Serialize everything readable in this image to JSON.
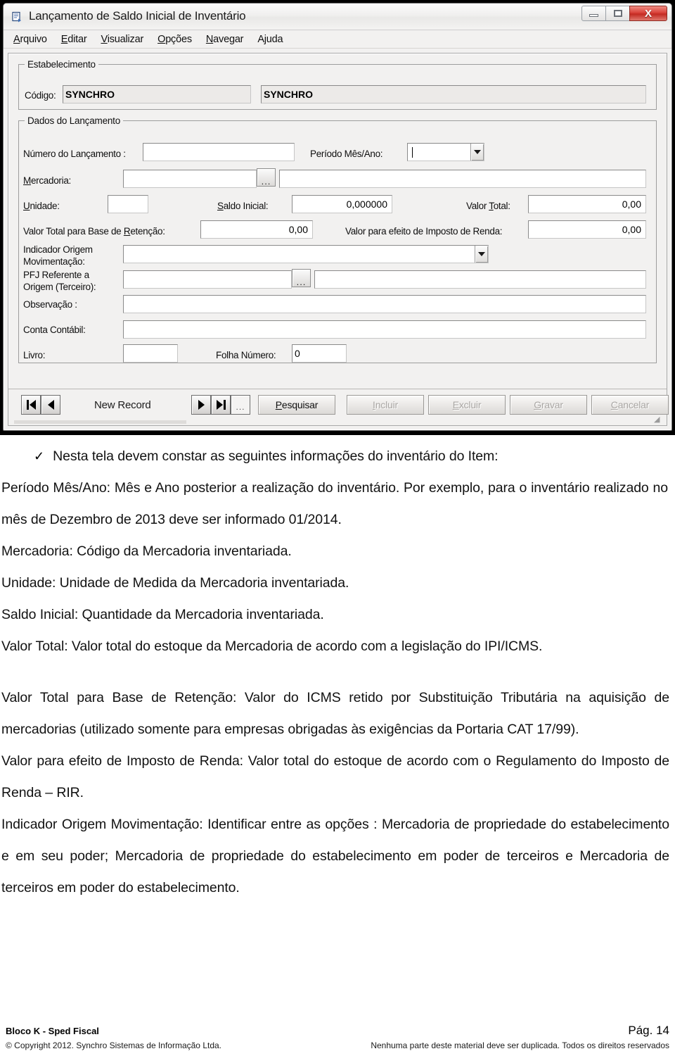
{
  "window": {
    "title": "Lançamento de Saldo Inicial de Inventário",
    "titlebar_icon": "app-document-icon",
    "controls": {
      "minimize": "minimize-icon",
      "maximize": "maximize-icon",
      "close_label": "X"
    },
    "menu": [
      {
        "label": "Arquivo",
        "accel": "A"
      },
      {
        "label": "Editar",
        "accel": "E"
      },
      {
        "label": "Visualizar",
        "accel": "V"
      },
      {
        "label": "Opções",
        "accel": "O"
      },
      {
        "label": "Navegar",
        "accel": "N"
      },
      {
        "label": "Ajuda",
        "accel": ""
      }
    ],
    "group_estabelecimento": {
      "legend": "Estabelecimento",
      "codigo_label": "Código:",
      "codigo_value": "SYNCHRO",
      "nome_value": "SYNCHRO"
    },
    "group_dados": {
      "legend": "Dados do Lançamento",
      "numero_lancamento_label": "Número do Lançamento :",
      "numero_lancamento_value": "",
      "periodo_label": "Período Mês/Ano:",
      "periodo_value": "",
      "mercadoria_label": "Mercadoria:",
      "mercadoria_accel": "M",
      "mercadoria_value": "",
      "mercadoria_desc_value": "",
      "mercadoria_lookup_label": "...",
      "unidade_label": "Unidade:",
      "unidade_accel": "U",
      "unidade_value": "",
      "saldo_inicial_label": "Saldo Inicial:",
      "saldo_inicial_accel": "S",
      "saldo_inicial_value": "0,000000",
      "valor_total_label": "Valor Total:",
      "valor_total_accel": "T",
      "valor_total_value": "0,00",
      "base_retencao_label": "Valor Total para Base de Retenção:",
      "base_retencao_accel": "R",
      "base_retencao_value": "0,00",
      "imposto_renda_label": "Valor para efeito de Imposto de Renda:",
      "imposto_renda_value": "0,00",
      "indicador_origem_label_l1": "Indicador Origem",
      "indicador_origem_label_l2": "Movimentação:",
      "indicador_origem_value": "",
      "pfj_label_l1": "PFJ Referente a",
      "pfj_label_l2": "Origem (Terceiro):",
      "pfj_value": "",
      "pfj_desc_value": "",
      "pfj_lookup_label": "...",
      "observacao_label": "Observação :",
      "observacao_value": "",
      "conta_contabil_label": "Conta Contábil:",
      "conta_contabil_value": "",
      "livro_label": "Livro:",
      "livro_value": "",
      "folha_numero_label": "Folha Número:",
      "folha_numero_value": "0"
    },
    "toolbar": {
      "record_status": "New Record",
      "first_icon": "first-record-icon",
      "prev_icon": "previous-record-icon",
      "next_icon": "next-record-icon",
      "last_icon": "last-record-icon",
      "more_label": "...",
      "pesquisar_label": "Pesquisar",
      "pesquisar_accel": "P",
      "incluir_label": "Incluir",
      "incluir_accel": "I",
      "excluir_label": "Excluir",
      "excluir_accel": "E",
      "gravar_label": "Gravar",
      "gravar_accel": "G",
      "cancelar_label": "Cancelar",
      "cancelar_accel": "C"
    }
  },
  "document": {
    "bullet_glyph": "✓",
    "bullet_text": "Nesta tela devem constar as seguintes informações do inventário do Item:",
    "paragraphs": [
      "Período Mês/Ano: Mês e Ano posterior a realização do inventário. Por exemplo, para o inventário realizado no mês de Dezembro de 2013 deve ser informado 01/2014.",
      "Mercadoria: Código da Mercadoria inventariada.",
      "Unidade: Unidade de Medida da Mercadoria inventariada.",
      "Saldo Inicial: Quantidade da Mercadoria inventariada.",
      "Valor Total: Valor total do estoque da Mercadoria de acordo com a legislação do IPI/ICMS.",
      "Valor Total para Base de Retenção: Valor do ICMS retido por Substituição Tributária na aquisição de",
      "mercadorias (utilizado somente para empresas obrigadas às exigências da Portaria CAT 17/99).",
      "Valor para efeito de Imposto de Renda: Valor total do estoque de acordo com o Regulamento do Imposto de Renda – RIR.",
      "Indicador Origem Movimentação: Identificar entre as opções : Mercadoria de propriedade do estabelecimento e em seu poder; Mercadoria de propriedade do estabelecimento em poder de terceiros e Mercadoria de terceiros em poder do estabelecimento."
    ]
  },
  "footer": {
    "left_top": "Bloco K - Sped Fiscal",
    "left_bottom": "© Copyright 2012. Synchro Sistemas de Informação Ltda.",
    "right_top": "Pág. 14",
    "right_bottom": "Nenhuma parte deste material deve ser duplicada. Todos os direitos reservados"
  }
}
